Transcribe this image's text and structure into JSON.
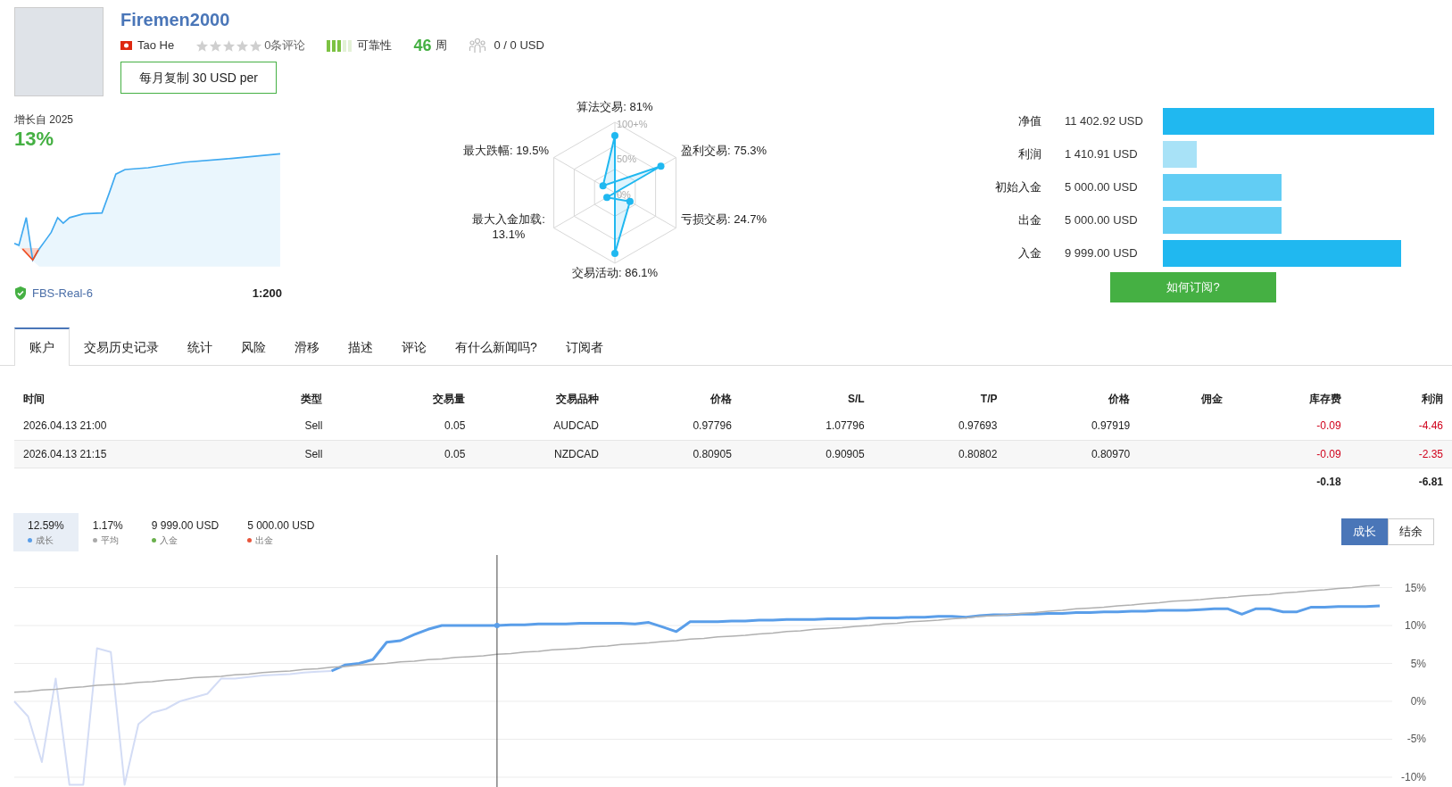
{
  "profile": {
    "name": "Firemen2000",
    "owner": "Tao He",
    "stars": 0,
    "reviews": "0条评论",
    "reliability": {
      "label": "可靠性",
      "level": 0.6
    },
    "weeks": "46",
    "weeks_unit": "周",
    "subscribers": "0 / 0 USD",
    "copy_button": "每月复制 30 USD per"
  },
  "growth": {
    "label": "增长自 2025",
    "value": "13%",
    "server": "FBS-Real-6",
    "leverage": "1:200"
  },
  "radar": {
    "grid_labels": [
      "100+%",
      "50%",
      "0%"
    ],
    "axes": [
      {
        "label": "算法交易:",
        "value": "81%"
      },
      {
        "label": "最大跌幅:",
        "value": "19.5%"
      },
      {
        "label": "盈利交易:",
        "value": "75.3%"
      },
      {
        "label": "最大入金加载:",
        "value": "13.1%"
      },
      {
        "label": "亏损交易:",
        "value": "24.7%"
      },
      {
        "label": "交易活动:",
        "value": "86.1%"
      }
    ]
  },
  "balances": [
    {
      "label": "净值",
      "value": "11 402.92 USD",
      "color": "#20b8f0"
    },
    {
      "label": "利润",
      "value": "1 410.91 USD",
      "color": "#a8e2f7"
    },
    {
      "label": "初始入金",
      "value": "5 000.00 USD",
      "color": "#62cdf4"
    },
    {
      "label": "出金",
      "value": "5 000.00 USD",
      "color": "#62cdf4"
    },
    {
      "label": "入金",
      "value": "9 999.00 USD",
      "color": "#20b8f0"
    }
  ],
  "subscribe_button": "如何订阅?",
  "tabs": [
    {
      "label": "账户",
      "selected": true
    },
    {
      "label": "交易历史记录",
      "selected": false
    },
    {
      "label": "统计",
      "selected": false
    },
    {
      "label": "风险",
      "selected": false
    },
    {
      "label": "滑移",
      "selected": false
    },
    {
      "label": "描述",
      "selected": false
    },
    {
      "label": "评论",
      "selected": false
    },
    {
      "label": "有什么新闻吗?",
      "selected": false
    },
    {
      "label": "订阅者",
      "selected": false
    }
  ],
  "table": {
    "columns": [
      {
        "label": "时间",
        "colored": false
      },
      {
        "label": "类型",
        "colored": false
      },
      {
        "label": "交易量",
        "colored": false
      },
      {
        "label": "交易品种",
        "colored": false
      },
      {
        "label": "价格",
        "colored": false
      },
      {
        "label": "S/L",
        "colored": false
      },
      {
        "label": "T/P",
        "colored": false
      },
      {
        "label": "价格",
        "colored": false
      },
      {
        "label": "佣金"
      },
      {
        "label": "库存费",
        "colored": true
      },
      {
        "label": "利润",
        "colored": true
      }
    ],
    "rows": [
      [
        "2026.04.13 21:00",
        "Sell",
        "0.05",
        "AUDCAD",
        "0.97796",
        "1.07796",
        "0.97693",
        "0.97919",
        "",
        "-0.09",
        "-4.46"
      ],
      [
        "2026.04.13 21:15",
        "Sell",
        "0.05",
        "NZDCAD",
        "0.80905",
        "0.90905",
        "0.80802",
        "0.80970",
        "",
        "-0.09",
        "-2.35"
      ]
    ],
    "totals": {
      "swap": "-0.18",
      "profit": "-6.81"
    }
  },
  "legend": [
    {
      "value": "12.59%",
      "label": "成长",
      "color": "#5a9ee9",
      "selected": true
    },
    {
      "value": "1.17%",
      "label": "平均",
      "color": "#aaaaaa",
      "selected": false
    },
    {
      "value": "9 999.00 USD",
      "label": "入金",
      "color": "#6ab04c",
      "selected": false
    },
    {
      "value": "5 000.00 USD",
      "label": "出金",
      "color": "#e8553b",
      "selected": false
    }
  ],
  "chart_toggle": [
    {
      "label": "成长",
      "selected": true
    },
    {
      "label": "结余",
      "selected": false
    }
  ],
  "chart_data": {
    "type": "line",
    "grid": true,
    "ylim": [
      -11.3,
      19.3
    ],
    "yticks": [
      {
        "value": 15,
        "label": "15%"
      },
      {
        "value": 10,
        "label": "10%"
      },
      {
        "value": 5,
        "label": "5%"
      },
      {
        "value": 0,
        "label": "0%"
      },
      {
        "value": -5,
        "label": "-5%"
      },
      {
        "value": -10,
        "label": "-10%"
      }
    ],
    "series": [
      {
        "color": "#d3dcf5",
        "values": [
          0,
          -2,
          -8,
          3,
          -11,
          -11,
          7,
          6.5,
          -11,
          -3,
          -1.5,
          -1,
          0,
          0.5,
          1,
          3,
          3,
          3.2,
          3.4,
          3.5,
          3.6,
          3.8,
          3.9,
          4,
          null,
          null,
          null,
          null,
          null,
          null,
          null,
          null,
          null,
          null,
          null,
          null,
          null,
          null,
          null,
          null,
          null,
          null,
          null,
          null,
          null,
          null,
          null,
          null,
          null,
          null,
          null,
          null,
          null,
          null,
          null,
          null,
          null,
          null,
          null,
          null,
          null,
          null,
          null,
          null,
          null,
          null,
          null,
          null,
          null,
          null,
          null,
          null,
          null,
          null,
          null,
          null,
          null,
          null,
          null,
          null,
          null,
          null,
          null,
          null,
          null,
          null,
          null,
          null,
          null,
          null,
          null,
          null,
          null,
          null,
          null,
          null,
          null,
          null,
          null,
          null
        ]
      },
      {
        "color": "#5a9ee9",
        "values": [
          null,
          null,
          null,
          null,
          null,
          null,
          null,
          null,
          null,
          null,
          null,
          null,
          null,
          null,
          null,
          null,
          null,
          null,
          null,
          null,
          null,
          null,
          null,
          4,
          4.8,
          5,
          5.5,
          7.8,
          8,
          8.8,
          9.5,
          10,
          10,
          10,
          10,
          10,
          10.1,
          10.1,
          10.2,
          10.2,
          10.2,
          10.3,
          10.3,
          10.3,
          10.3,
          10.2,
          10.4,
          9.8,
          9.2,
          10.5,
          10.5,
          10.5,
          10.6,
          10.6,
          10.7,
          10.7,
          10.8,
          10.8,
          10.8,
          10.9,
          10.9,
          10.9,
          11,
          11,
          11,
          11.1,
          11.1,
          11.2,
          11.2,
          11.1,
          11.3,
          11.4,
          11.4,
          11.5,
          11.5,
          11.6,
          11.6,
          11.7,
          11.7,
          11.8,
          11.8,
          11.9,
          11.9,
          12,
          12,
          12,
          12.1,
          12.2,
          12.2,
          11.5,
          12.2,
          12.2,
          11.8,
          11.8,
          12.4,
          12.4,
          12.5,
          12.5,
          12.5,
          12.6
        ]
      },
      {
        "color": "#b0b0b0",
        "values": [
          1.2,
          1.3,
          1.5,
          1.6,
          1.8,
          1.9,
          2.1,
          2.2,
          2.3,
          2.5,
          2.6,
          2.8,
          2.9,
          3.1,
          3.2,
          3.3,
          3.5,
          3.6,
          3.8,
          3.9,
          4.0,
          4.2,
          4.3,
          4.5,
          4.6,
          4.8,
          4.9,
          5.0,
          5.2,
          5.3,
          5.5,
          5.6,
          5.8,
          5.9,
          6.0,
          6.2,
          6.3,
          6.5,
          6.6,
          6.8,
          6.9,
          7.0,
          7.2,
          7.3,
          7.5,
          7.6,
          7.7,
          7.9,
          8.0,
          8.2,
          8.3,
          8.5,
          8.6,
          8.7,
          8.9,
          9.0,
          9.2,
          9.3,
          9.5,
          9.6,
          9.7,
          9.9,
          10.0,
          10.2,
          10.3,
          10.5,
          10.6,
          10.7,
          10.9,
          11.0,
          11.2,
          11.3,
          11.4,
          11.6,
          11.7,
          11.9,
          12.0,
          12.2,
          12.3,
          12.4,
          12.6,
          12.7,
          12.9,
          13.0,
          13.2,
          13.3,
          13.4,
          13.6,
          13.7,
          13.9,
          14.0,
          14.1,
          14.3,
          14.4,
          14.6,
          14.7,
          14.9,
          15.0,
          15.2,
          15.3
        ]
      }
    ]
  }
}
